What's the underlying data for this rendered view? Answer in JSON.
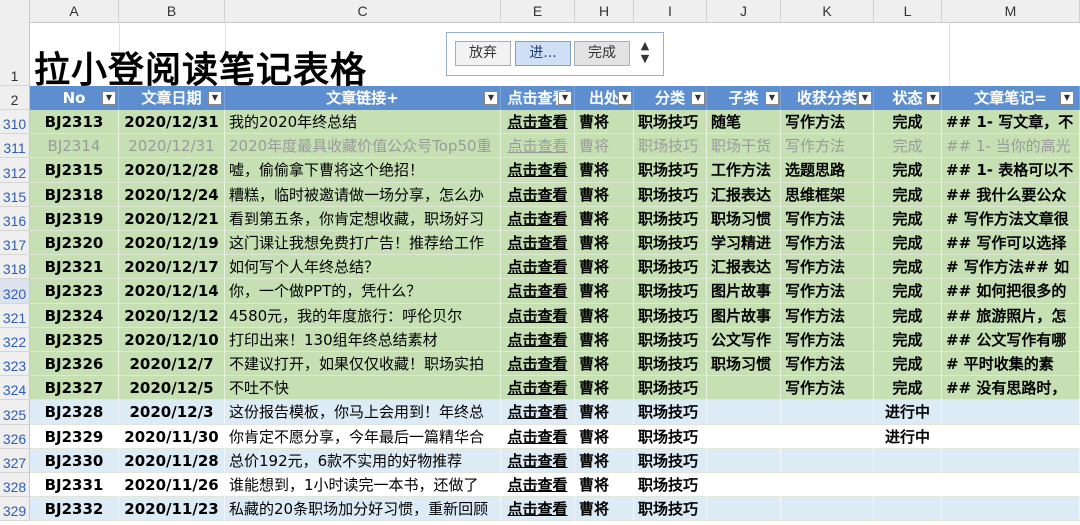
{
  "columns": [
    "A",
    "B",
    "C",
    "E",
    "H",
    "I",
    "J",
    "K",
    "L",
    "M"
  ],
  "title": "拉小登阅读笔记表格",
  "controls": {
    "btn_give_up": "放弃",
    "btn_progress": "进...",
    "btn_done": "完成",
    "spin_up": "▲",
    "spin_down": "▼"
  },
  "row_labels": {
    "title_row": "1",
    "header_row": "2"
  },
  "headers": [
    "No",
    "文章日期",
    "文章链接+",
    "点击查看",
    "出处",
    "分类",
    "子类",
    "收获分类",
    "状态",
    "文章笔记="
  ],
  "rows": [
    {
      "n": "310",
      "no": "BJ2313",
      "date": "2020/12/31",
      "title": "我的2020年终总结",
      "link": "点击查看",
      "src": "曹将",
      "cat": "职场技巧",
      "sub": "随笔",
      "gain": "写作方法",
      "status": "完成",
      "note": "## 1- 写文章，不",
      "style": "green"
    },
    {
      "n": "311",
      "no": "BJ2314",
      "date": "2020/12/31",
      "title": "2020年度最具收藏价值公众号Top50重",
      "link": "点击查看",
      "src": "曹将",
      "cat": "职场技巧",
      "sub": "职场干货",
      "gain": "写作方法",
      "status": "完成",
      "note": "## 1- 当你的高光",
      "style": "dim"
    },
    {
      "n": "312",
      "no": "BJ2315",
      "date": "2020/12/28",
      "title": "嘘，偷偷拿下曹将这个绝招！",
      "link": "点击查看",
      "src": "曹将",
      "cat": "职场技巧",
      "sub": "工作方法",
      "gain": "选题思路",
      "status": "完成",
      "note": "## 1- 表格可以不",
      "style": "green"
    },
    {
      "n": "315",
      "no": "BJ2318",
      "date": "2020/12/24",
      "title": "糟糕，临时被邀请做一场分享，怎么办",
      "link": "点击查看",
      "src": "曹将",
      "cat": "职场技巧",
      "sub": "汇报表达",
      "gain": "思维框架",
      "status": "完成",
      "note": "## 我什么要公众",
      "style": "green"
    },
    {
      "n": "316",
      "no": "BJ2319",
      "date": "2020/12/21",
      "title": "看到第五条，你肯定想收藏，职场好习",
      "link": "点击查看",
      "src": "曹将",
      "cat": "职场技巧",
      "sub": "职场习惯",
      "gain": "写作方法",
      "status": "完成",
      "note": "# 写作方法文章很",
      "style": "green"
    },
    {
      "n": "317",
      "no": "BJ2320",
      "date": "2020/12/19",
      "title": "这门课让我想免费打广告！推荐给工作",
      "link": "点击查看",
      "src": "曹将",
      "cat": "职场技巧",
      "sub": "学习精进",
      "gain": "写作方法",
      "status": "完成",
      "note": "## 写作可以选择",
      "style": "green"
    },
    {
      "n": "318",
      "no": "BJ2321",
      "date": "2020/12/17",
      "title": "如何写个人年终总结？",
      "link": "点击查看",
      "src": "曹将",
      "cat": "职场技巧",
      "sub": "汇报表达",
      "gain": "写作方法",
      "status": "完成",
      "note": "# 写作方法## 如",
      "style": "green"
    },
    {
      "n": "320",
      "no": "BJ2323",
      "date": "2020/12/14",
      "title": "你，一个做PPT的，凭什么？",
      "link": "点击查看",
      "src": "曹将",
      "cat": "职场技巧",
      "sub": "图片故事",
      "gain": "写作方法",
      "status": "完成",
      "note": "## 如何把很多的",
      "style": "green"
    },
    {
      "n": "321",
      "no": "BJ2324",
      "date": "2020/12/12",
      "title": "4580元，我的年度旅行：呼伦贝尔",
      "link": "点击查看",
      "src": "曹将",
      "cat": "职场技巧",
      "sub": "图片故事",
      "gain": "写作方法",
      "status": "完成",
      "note": "## 旅游照片，怎",
      "style": "green"
    },
    {
      "n": "322",
      "no": "BJ2325",
      "date": "2020/12/10",
      "title": "打印出来！130组年终总结素材",
      "link": "点击查看",
      "src": "曹将",
      "cat": "职场技巧",
      "sub": "公文写作",
      "gain": "写作方法",
      "status": "完成",
      "note": "## 公文写作有哪",
      "style": "green"
    },
    {
      "n": "323",
      "no": "BJ2326",
      "date": "2020/12/7",
      "title": "不建议打开，如果仅仅收藏！职场实拍",
      "link": "点击查看",
      "src": "曹将",
      "cat": "职场技巧",
      "sub": "职场习惯",
      "gain": "写作方法",
      "status": "完成",
      "note": "# 平时收集的素",
      "style": "green"
    },
    {
      "n": "324",
      "no": "BJ2327",
      "date": "2020/12/5",
      "title": "不吐不快",
      "link": "点击查看",
      "src": "曹将",
      "cat": "职场技巧",
      "sub": "",
      "gain": "写作方法",
      "status": "完成",
      "note": "## 没有思路时，",
      "style": "green"
    },
    {
      "n": "325",
      "no": "BJ2328",
      "date": "2020/12/3",
      "title": "这份报告模板，你马上会用到！年终总",
      "link": "点击查看",
      "src": "曹将",
      "cat": "职场技巧",
      "sub": "",
      "gain": "",
      "status": "进行中",
      "note": "",
      "style": "blue"
    },
    {
      "n": "326",
      "no": "BJ2329",
      "date": "2020/11/30",
      "title": "你肯定不愿分享，今年最后一篇精华合",
      "link": "点击查看",
      "src": "曹将",
      "cat": "职场技巧",
      "sub": "",
      "gain": "",
      "status": "进行中",
      "note": "",
      "style": "white"
    },
    {
      "n": "327",
      "no": "BJ2330",
      "date": "2020/11/28",
      "title": "总价192元，6款不实用的好物推荐",
      "link": "点击查看",
      "src": "曹将",
      "cat": "职场技巧",
      "sub": "",
      "gain": "",
      "status": "",
      "note": "",
      "style": "blue"
    },
    {
      "n": "328",
      "no": "BJ2331",
      "date": "2020/11/26",
      "title": "谁能想到，1小时读完一本书，还做了",
      "link": "点击查看",
      "src": "曹将",
      "cat": "职场技巧",
      "sub": "",
      "gain": "",
      "status": "",
      "note": "",
      "style": "white"
    },
    {
      "n": "329",
      "no": "BJ2332",
      "date": "2020/11/23",
      "title": "私藏的20条职场加分好习惯，重新回顾",
      "link": "点击查看",
      "src": "曹将",
      "cat": "职场技巧",
      "sub": "",
      "gain": "",
      "status": "",
      "note": "",
      "style": "blue"
    }
  ]
}
